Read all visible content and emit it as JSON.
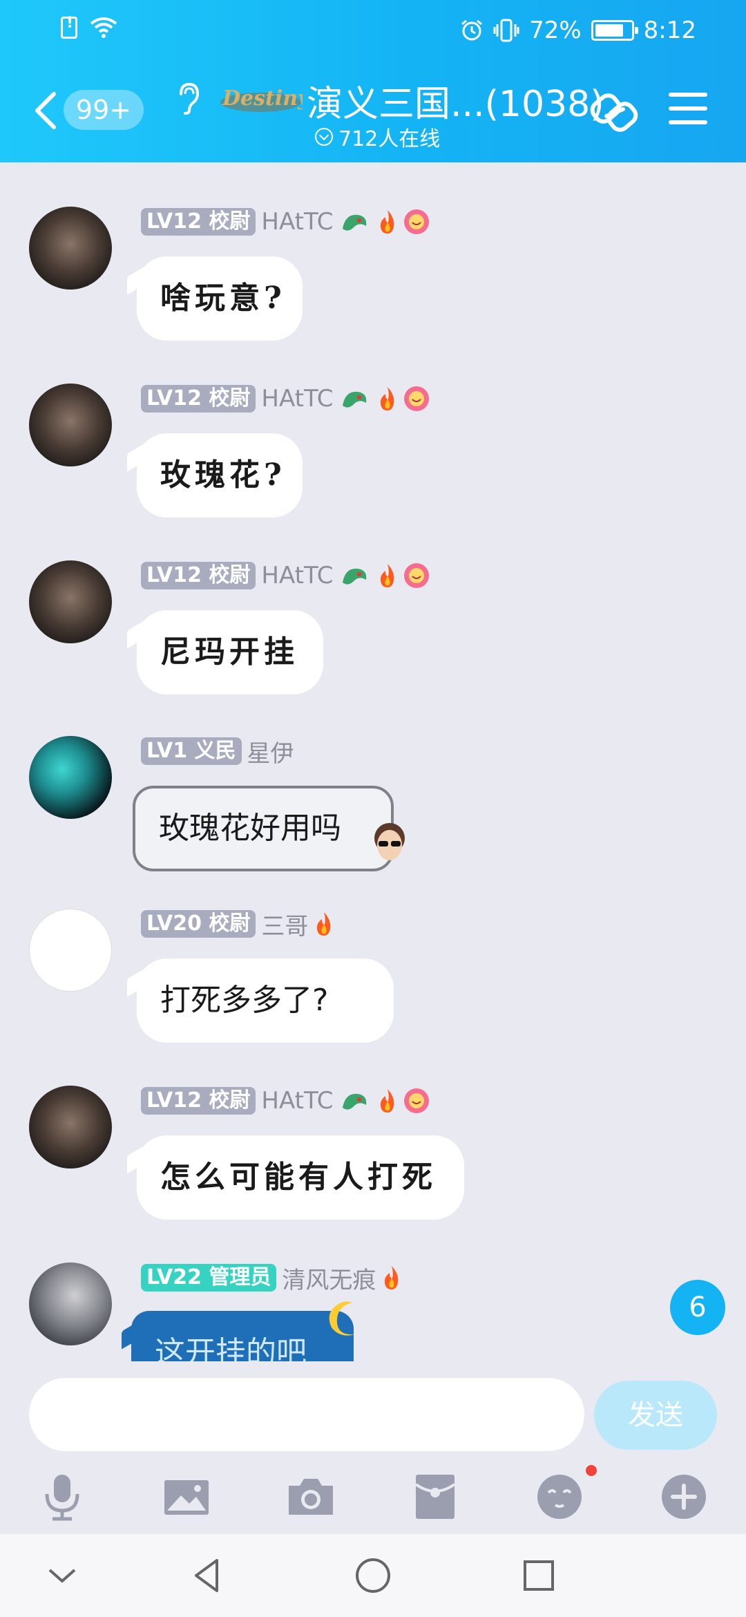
{
  "status": {
    "battery": "72%",
    "time": "8:12"
  },
  "header": {
    "unread_badge": "99+",
    "title": "演义三国...(1038)",
    "online": "712人在线",
    "logo_text": "Destiny"
  },
  "messages": [
    {
      "level": "LV12 校尉",
      "name": "HAtTC",
      "text": "啥玩意?"
    },
    {
      "level": "LV12 校尉",
      "name": "HAtTC",
      "text": "玫瑰花?"
    },
    {
      "level": "LV12 校尉",
      "name": "HAtTC",
      "text": "尼玛开挂"
    },
    {
      "level": "LV1 义民",
      "name": "星伊",
      "text": "玫瑰花好用吗"
    },
    {
      "level": "LV20 校尉",
      "name": "三哥",
      "text": "打死多多了?"
    },
    {
      "level": "LV12 校尉",
      "name": "HAtTC",
      "text": "怎么可能有人打死"
    },
    {
      "level": "LV22 管理员",
      "name": "清风无痕",
      "text": "这开挂的吧"
    }
  ],
  "unread_count": "6",
  "input": {
    "placeholder": "",
    "send_label": "发送"
  },
  "colors": {
    "header": "#14b4f4",
    "background": "#e9eaf1",
    "admin_badge": "#37d3c2",
    "level_badge": "#a9acbf"
  }
}
